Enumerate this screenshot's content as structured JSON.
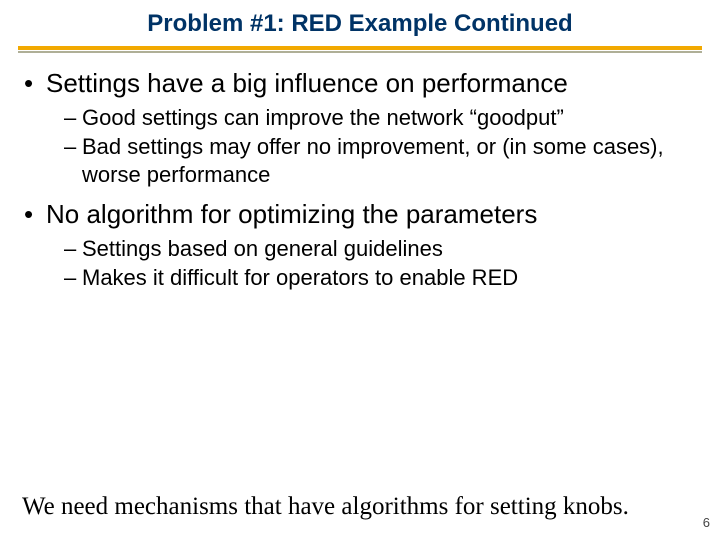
{
  "title": "Problem #1: RED Example Continued",
  "bullets": [
    {
      "text": "Settings have a big influence on performance",
      "sub": [
        "Good settings can improve the network “goodput”",
        "Bad settings may offer no improvement, or (in some cases), worse performance"
      ]
    },
    {
      "text": "No algorithm for optimizing the parameters",
      "sub": [
        "Settings based on general guidelines",
        "Makes it difficult for operators to enable RED"
      ]
    }
  ],
  "footer_note": "We need mechanisms that have algorithms for setting knobs.",
  "page_number": "6"
}
